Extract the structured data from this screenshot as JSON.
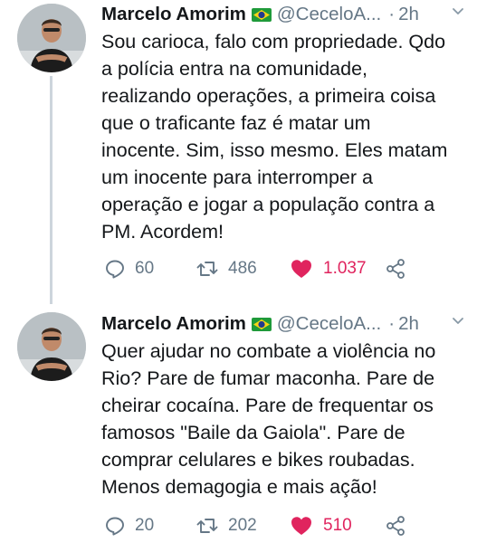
{
  "tweets": [
    {
      "author_name": "Marcelo Amorim",
      "flag": "brazil-flag",
      "handle": "@CeceloA...",
      "time": "2h",
      "text": "Sou carioca, falo com propriedade. Qdo\na polícia entra na comunidade,\nrealizando operações, a primeira coisa\nque o traficante faz é matar um\ninocente. Sim, isso mesmo. Eles matam\num inocente para interromper a\noperação e jogar a população contra a\nPM. Acordem!",
      "replies": "60",
      "retweets": "486",
      "likes": "1.037"
    },
    {
      "author_name": "Marcelo Amorim",
      "flag": "brazil-flag",
      "handle": "@CeceloA...",
      "time": "2h",
      "text": "Quer ajudar no combate a violência no\nRio? Pare de fumar maconha. Pare de\ncheirar cocaína. Pare de frequentar os\nfamosos \"Baile da Gaiola\". Pare de\ncomprar celulares e bikes roubadas.\nMenos demagogia e mais ação!",
      "replies": "20",
      "retweets": "202",
      "likes": "510"
    }
  ],
  "separator": "·",
  "colors": {
    "text": "#14171a",
    "secondary": "#657786",
    "like": "#e0245e",
    "thread_line": "#cdd5dc"
  },
  "icons": [
    "reply-icon",
    "retweet-icon",
    "heart-icon",
    "share-icon",
    "chevron-down-icon"
  ]
}
